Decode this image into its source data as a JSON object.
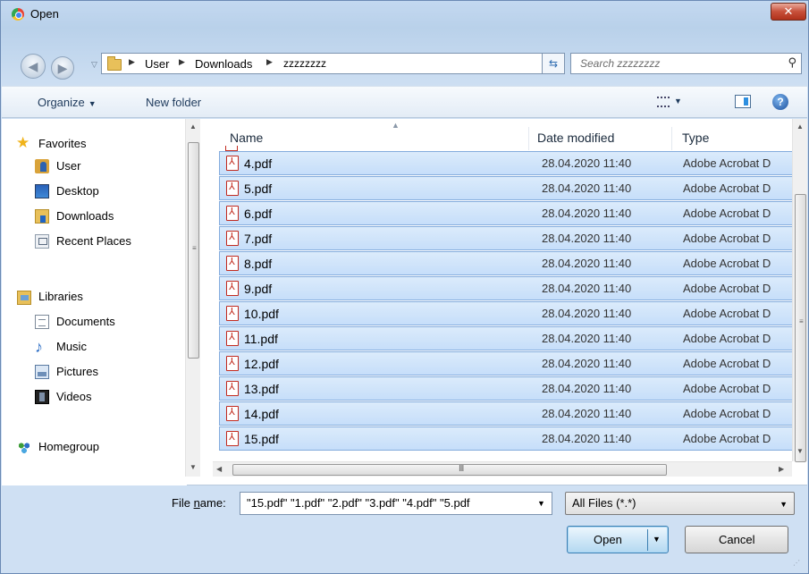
{
  "window": {
    "title": "Open",
    "close_glyph": "✕"
  },
  "address": {
    "crumbs": [
      "User",
      "Downloads",
      "zzzzzzzz"
    ],
    "search_placeholder": "Search zzzzzzzz"
  },
  "toolbar": {
    "organize": "Organize",
    "new_folder": "New folder"
  },
  "nav": {
    "favorites": "Favorites",
    "favorite_items": [
      "User",
      "Desktop",
      "Downloads",
      "Recent Places"
    ],
    "libraries": "Libraries",
    "library_items": [
      "Documents",
      "Music",
      "Pictures",
      "Videos"
    ],
    "homegroup": "Homegroup"
  },
  "columns": {
    "name": "Name",
    "date": "Date modified",
    "type": "Type"
  },
  "files": [
    {
      "name": "4.pdf",
      "date": "28.04.2020 11:40",
      "type": "Adobe Acrobat D"
    },
    {
      "name": "5.pdf",
      "date": "28.04.2020 11:40",
      "type": "Adobe Acrobat D"
    },
    {
      "name": "6.pdf",
      "date": "28.04.2020 11:40",
      "type": "Adobe Acrobat D"
    },
    {
      "name": "7.pdf",
      "date": "28.04.2020 11:40",
      "type": "Adobe Acrobat D"
    },
    {
      "name": "8.pdf",
      "date": "28.04.2020 11:40",
      "type": "Adobe Acrobat D"
    },
    {
      "name": "9.pdf",
      "date": "28.04.2020 11:40",
      "type": "Adobe Acrobat D"
    },
    {
      "name": "10.pdf",
      "date": "28.04.2020 11:40",
      "type": "Adobe Acrobat D"
    },
    {
      "name": "11.pdf",
      "date": "28.04.2020 11:40",
      "type": "Adobe Acrobat D"
    },
    {
      "name": "12.pdf",
      "date": "28.04.2020 11:40",
      "type": "Adobe Acrobat D"
    },
    {
      "name": "13.pdf",
      "date": "28.04.2020 11:40",
      "type": "Adobe Acrobat D"
    },
    {
      "name": "14.pdf",
      "date": "28.04.2020 11:40",
      "type": "Adobe Acrobat D"
    },
    {
      "name": "15.pdf",
      "date": "28.04.2020 11:40",
      "type": "Adobe Acrobat D"
    }
  ],
  "footer": {
    "file_name_label_pre": "File ",
    "file_name_label_u": "n",
    "file_name_label_post": "ame:",
    "file_name_value": "\"15.pdf\" \"1.pdf\" \"2.pdf\" \"3.pdf\" \"4.pdf\" \"5.pdf",
    "filter": "All Files (*.*)",
    "open": "Open",
    "cancel": "Cancel"
  },
  "colors": {
    "selection": "#c6defa",
    "selection_border": "#84acdd",
    "pdf_red": "#c22a1f"
  },
  "icons": [
    "chrome-icon",
    "back-icon",
    "forward-icon",
    "folder-icon",
    "refresh-icon",
    "search-icon",
    "view-icon",
    "preview-pane-icon",
    "help-icon",
    "star-icon",
    "pdf-icon"
  ]
}
